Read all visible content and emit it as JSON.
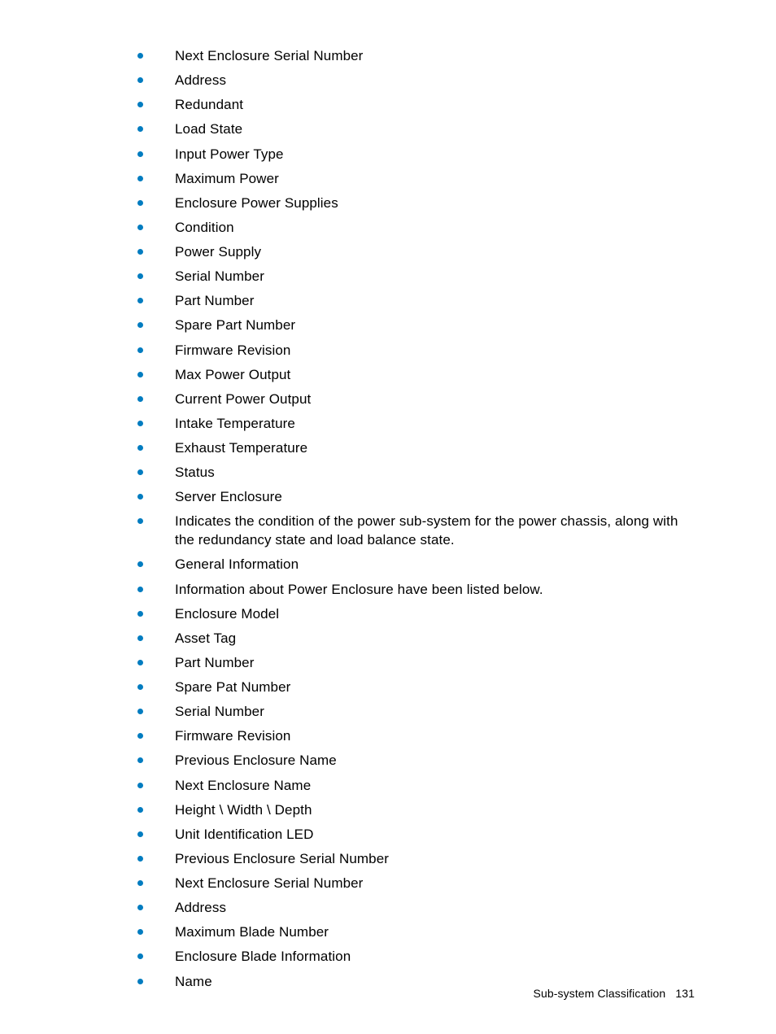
{
  "bullets": [
    "Next Enclosure Serial Number",
    "Address",
    "Redundant",
    "Load State",
    "Input Power Type",
    "Maximum Power",
    "Enclosure Power Supplies",
    "Condition",
    "Power Supply",
    "Serial Number",
    "Part Number",
    "Spare Part Number",
    "Firmware Revision",
    "Max Power Output",
    "Current Power Output",
    "Intake Temperature",
    "Exhaust Temperature",
    "Status",
    "Server Enclosure",
    "Indicates the condition of the power sub-system for the power chassis, along with the redundancy state and load balance state.",
    "General Information",
    "Information about Power Enclosure have been listed below.",
    "Enclosure Model",
    "Asset Tag",
    "Part Number",
    "Spare Pat Number",
    "Serial Number",
    "Firmware Revision",
    "Previous Enclosure Name",
    "Next Enclosure Name",
    "Height \\ Width \\ Depth",
    "Unit Identification LED",
    "Previous Enclosure Serial Number",
    "Next Enclosure Serial Number",
    "Address",
    "Maximum Blade Number",
    "Enclosure Blade Information",
    "Name"
  ],
  "footer": {
    "section": "Sub-system Classification",
    "page": "131"
  }
}
